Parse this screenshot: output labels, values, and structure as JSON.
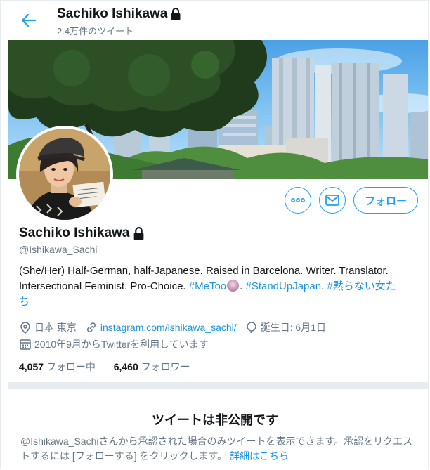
{
  "header": {
    "name": "Sachiko Ishikawa",
    "tweet_count": "2.4万件のツイート",
    "back_icon": "arrow-left-icon",
    "lock_icon": "lock-icon"
  },
  "profile": {
    "name": "Sachiko Ishikawa",
    "handle": "@Ishikawa_Sachi",
    "bio_line1": "(She/Her) Half-German, half-Japanese. Raised in Barcelona. Writer. Translator.",
    "bio_line2_text": "Intersectional Feminist. Pro-Choice.",
    "hashtag_metoo": "#MeToo",
    "separator": ".",
    "hashtag_standup": "#StandUpJapan",
    "hashtag_damaranai_a": "#黙らない女た",
    "hashtag_damaranai_b": "ち",
    "location": "日本 東京",
    "website": "instagram.com/ishikawa_sachi/",
    "birthday": "誕生日: 6月1日",
    "joined": "2010年9月からTwitterを利用しています",
    "following_count": "4,057",
    "following_label": "フォロー中",
    "followers_count": "6,460",
    "followers_label": "フォロワー"
  },
  "actions": {
    "more_icon": "more-icon",
    "message_icon": "envelope-icon",
    "follow_label": "フォロー"
  },
  "protected": {
    "title": "ツイートは非公開です",
    "text": "@Ishikawa_Sachiさんから承認された場合のみツイートを表示できます。承認をリクエストするには [フォローする] をクリックします。",
    "link": "詳細はこちら"
  },
  "colors": {
    "accent": "#1da1f2",
    "link": "#1b95e0",
    "muted": "#657786",
    "text": "#14171a",
    "divider": "#e6ecf0"
  }
}
